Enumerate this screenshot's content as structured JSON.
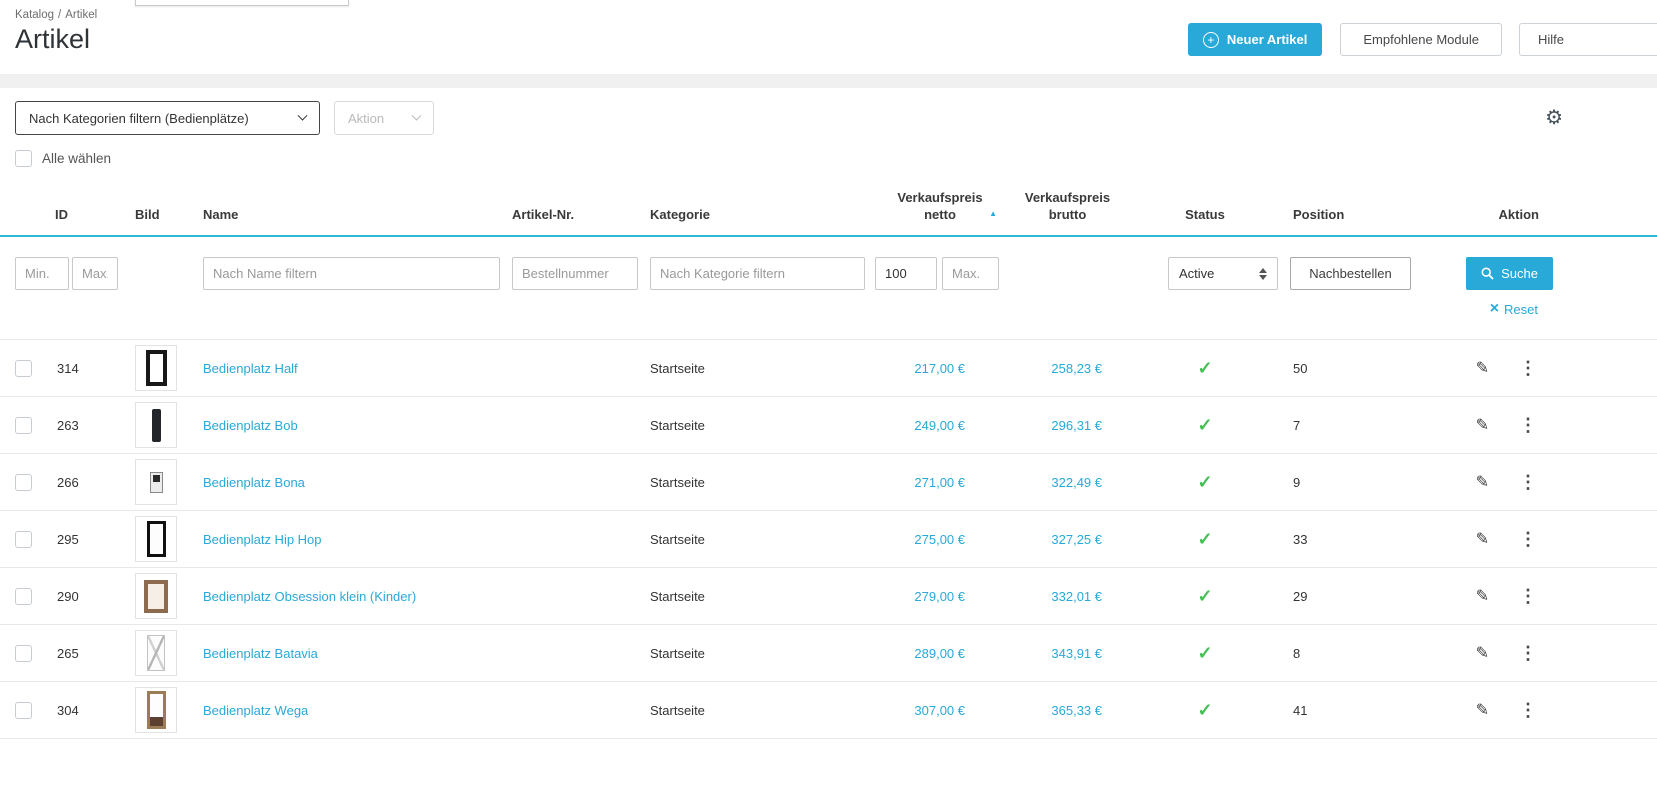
{
  "colors": {
    "accent": "#28a9d8",
    "header_underline": "#2cb9d4",
    "check_green": "#43bf53"
  },
  "top": {
    "breadcrumb": {
      "items": [
        "Katalog",
        "Artikel"
      ],
      "separator": "/"
    },
    "title": "Artikel",
    "buttons": {
      "new_article": "Neuer Artikel",
      "recommended_modules": "Empfohlene Module",
      "help": "Hilfe"
    }
  },
  "toolbar": {
    "category_filter_label": "Nach Kategorien filtern (Bedienplätze)",
    "action_label": "Aktion",
    "select_all_label": "Alle wählen"
  },
  "table": {
    "col_id": "ID",
    "col_bild": "Bild",
    "col_name": "Name",
    "col_artikelnr": "Artikel-Nr.",
    "col_kategorie": "Kategorie",
    "col_netto": [
      "Verkaufspreis",
      "netto"
    ],
    "col_brutto": [
      "Verkaufspreis",
      "brutto"
    ],
    "col_status": "Status",
    "col_position": "Position",
    "col_aktion": "Aktion"
  },
  "filters": {
    "id_min_placeholder": "Min.",
    "id_max_placeholder": "Max.",
    "name_placeholder": "Nach Name filtern",
    "ordernumber_placeholder": "Bestellnummer",
    "category_placeholder": "Nach Kategorie filtern",
    "price_min_value": "100",
    "price_max_placeholder": "Max.",
    "status_value": "Active",
    "reorder_button": "Nachbestellen",
    "search_button": "Suche",
    "reset_label": "Reset"
  },
  "rows": [
    {
      "id": "314",
      "image": "black-frame",
      "name": "Bedienplatz Half",
      "category": "Startseite",
      "price_net": "217,00 €",
      "price_gross": "258,23 €",
      "status": "active",
      "position": "50"
    },
    {
      "id": "263",
      "image": "black-panel",
      "name": "Bedienplatz Bob",
      "category": "Startseite",
      "price_net": "249,00 €",
      "price_gross": "296,31 €",
      "status": "active",
      "position": "7"
    },
    {
      "id": "266",
      "image": "small-white-device",
      "name": "Bedienplatz Bona",
      "category": "Startseite",
      "price_net": "271,00 €",
      "price_gross": "322,49 €",
      "status": "active",
      "position": "9"
    },
    {
      "id": "295",
      "image": "black-frame",
      "name": "Bedienplatz Hip Hop",
      "category": "Startseite",
      "price_net": "275,00 €",
      "price_gross": "327,25 €",
      "status": "active",
      "position": "33"
    },
    {
      "id": "290",
      "image": "brown-frame",
      "name": "Bedienplatz Obsession klein (Kinder)",
      "category": "Startseite",
      "price_net": "279,00 €",
      "price_gross": "332,01 €",
      "status": "active",
      "position": "29"
    },
    {
      "id": "265",
      "image": "white-folding-stand",
      "name": "Bedienplatz Batavia",
      "category": "Startseite",
      "price_net": "289,00 €",
      "price_gross": "343,91 €",
      "status": "active",
      "position": "8"
    },
    {
      "id": "304",
      "image": "wood-frame-mirror",
      "name": "Bedienplatz Wega",
      "category": "Startseite",
      "price_net": "307,00 €",
      "price_gross": "365,33 €",
      "status": "active",
      "position": "41"
    }
  ],
  "icons": {
    "plus": "+",
    "gear": "⚙",
    "sort_asc": "▲",
    "close": "×",
    "check": "✓",
    "edit": "✎",
    "kebab": "⋮",
    "chevron_down": "css-chevron",
    "search": "svg-magnifier",
    "select_arrows": "css-triangles"
  }
}
